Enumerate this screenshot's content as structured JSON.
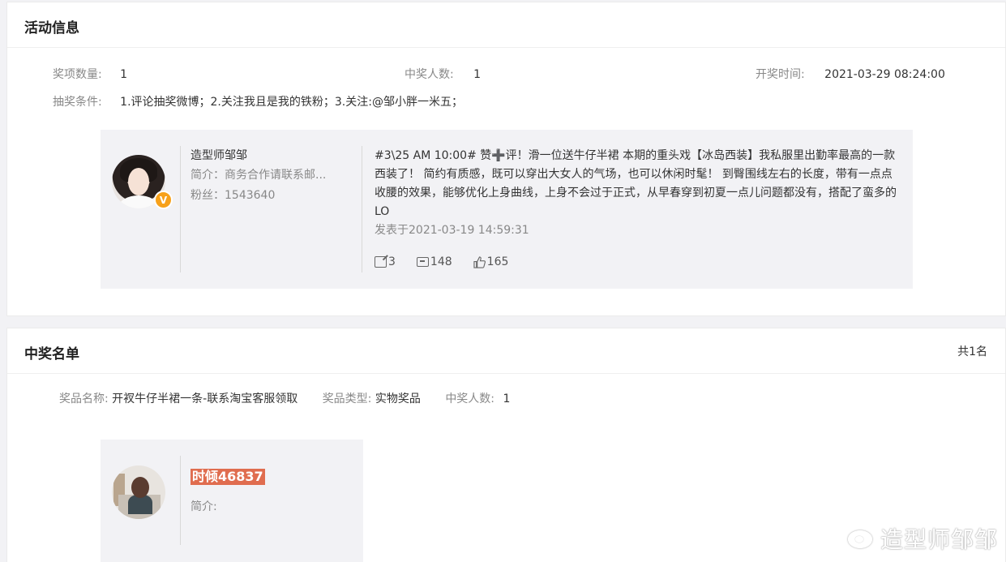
{
  "activity": {
    "title": "活动信息",
    "prize_count_label": "奖项数量:",
    "prize_count": "1",
    "winners_label": "中奖人数:",
    "winners": "1",
    "draw_time_label": "开奖时间:",
    "draw_time": "2021-03-29 08:24:00",
    "conditions_label": "抽奖条件:",
    "conditions": "1.评论抽奖微博；2.关注我且是我的铁粉；3.关注:@邹小胖一米五；"
  },
  "post": {
    "author": "造型师邹邹",
    "intro": "简介：商务合作请联系邮...",
    "fans": "粉丝：1543640",
    "badge": "V",
    "text": "#3\\25 AM 10:00# 赞➕评！滑一位送牛仔半裙  本期的重头戏【冰岛西装】我私服里出勤率最高的一款西装了！ 简约有质感，既可以穿出大女人的气场，也可以休闲时髦！ 到臀围线左右的长度，带有一点点收腰的效果，能够优化上身曲线，上身不会过于正式，从早春穿到初夏一点儿问题都没有，搭配了蛮多的LO",
    "date": "发表于2021-03-19 14:59:31",
    "reposts": "3",
    "comments": "148",
    "likes": "165"
  },
  "winners_list": {
    "title": "中奖名单",
    "count": "共1名",
    "prize_name_label": "奖品名称:",
    "prize_name": "开衩牛仔半裙一条-联系淘宝客服领取",
    "prize_type_label": "奖品类型:",
    "prize_type": "实物奖品",
    "winners_label": "中奖人数:",
    "winners": "1",
    "winner": {
      "name": "时倾46837",
      "intro": "简介:"
    }
  },
  "watermark": {
    "text": "造型师邹邹"
  },
  "colors": {
    "badge": "#f7a11a",
    "highlight": "#e06d4f",
    "panel": "#f2f2f5"
  }
}
